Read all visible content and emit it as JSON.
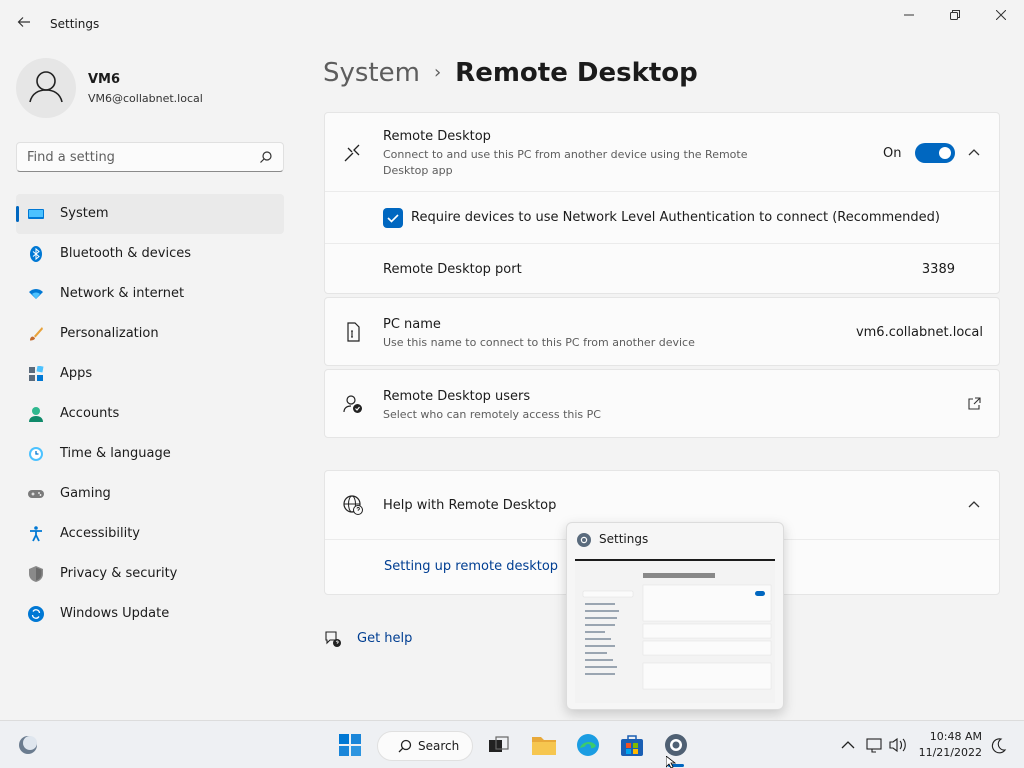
{
  "window": {
    "title": "Settings",
    "back_icon": "arrow-left-icon",
    "controls": [
      "minimize-icon",
      "restore-icon",
      "close-icon"
    ]
  },
  "profile": {
    "name": "VM6",
    "email": "VM6@collabnet.local"
  },
  "search": {
    "placeholder": "Find a setting"
  },
  "sidebar": {
    "items": [
      {
        "label": "System",
        "icon": "monitor-icon",
        "active": true
      },
      {
        "label": "Bluetooth & devices",
        "icon": "bluetooth-icon"
      },
      {
        "label": "Network & internet",
        "icon": "wifi-icon"
      },
      {
        "label": "Personalization",
        "icon": "brush-icon"
      },
      {
        "label": "Apps",
        "icon": "apps-icon"
      },
      {
        "label": "Accounts",
        "icon": "person-icon"
      },
      {
        "label": "Time & language",
        "icon": "clock-globe-icon"
      },
      {
        "label": "Gaming",
        "icon": "gamepad-icon"
      },
      {
        "label": "Accessibility",
        "icon": "accessibility-icon"
      },
      {
        "label": "Privacy & security",
        "icon": "shield-icon"
      },
      {
        "label": "Windows Update",
        "icon": "update-icon"
      }
    ]
  },
  "breadcrumb": {
    "parent": "System",
    "separator": "›",
    "current": "Remote Desktop"
  },
  "remote_desktop": {
    "title": "Remote Desktop",
    "description": "Connect to and use this PC from another device using the Remote Desktop app",
    "toggle_state": "On",
    "nla_label": "Require devices to use Network Level Authentication to connect (Recommended)",
    "port_label": "Remote Desktop port",
    "port_value": "3389"
  },
  "pc_name": {
    "title": "PC name",
    "description": "Use this name to connect to this PC from another device",
    "value": "vm6.collabnet.local"
  },
  "rd_users": {
    "title": "Remote Desktop users",
    "description": "Select who can remotely access this PC"
  },
  "help": {
    "title": "Help with Remote Desktop",
    "link": "Setting up remote desktop"
  },
  "get_help": "Get help",
  "thumbnail": {
    "title": "Settings"
  },
  "taskbar": {
    "search_label": "Search",
    "time": "10:48 AM",
    "date": "11/21/2022"
  },
  "colors": {
    "accent": "#0067c0",
    "link": "#003e92"
  }
}
